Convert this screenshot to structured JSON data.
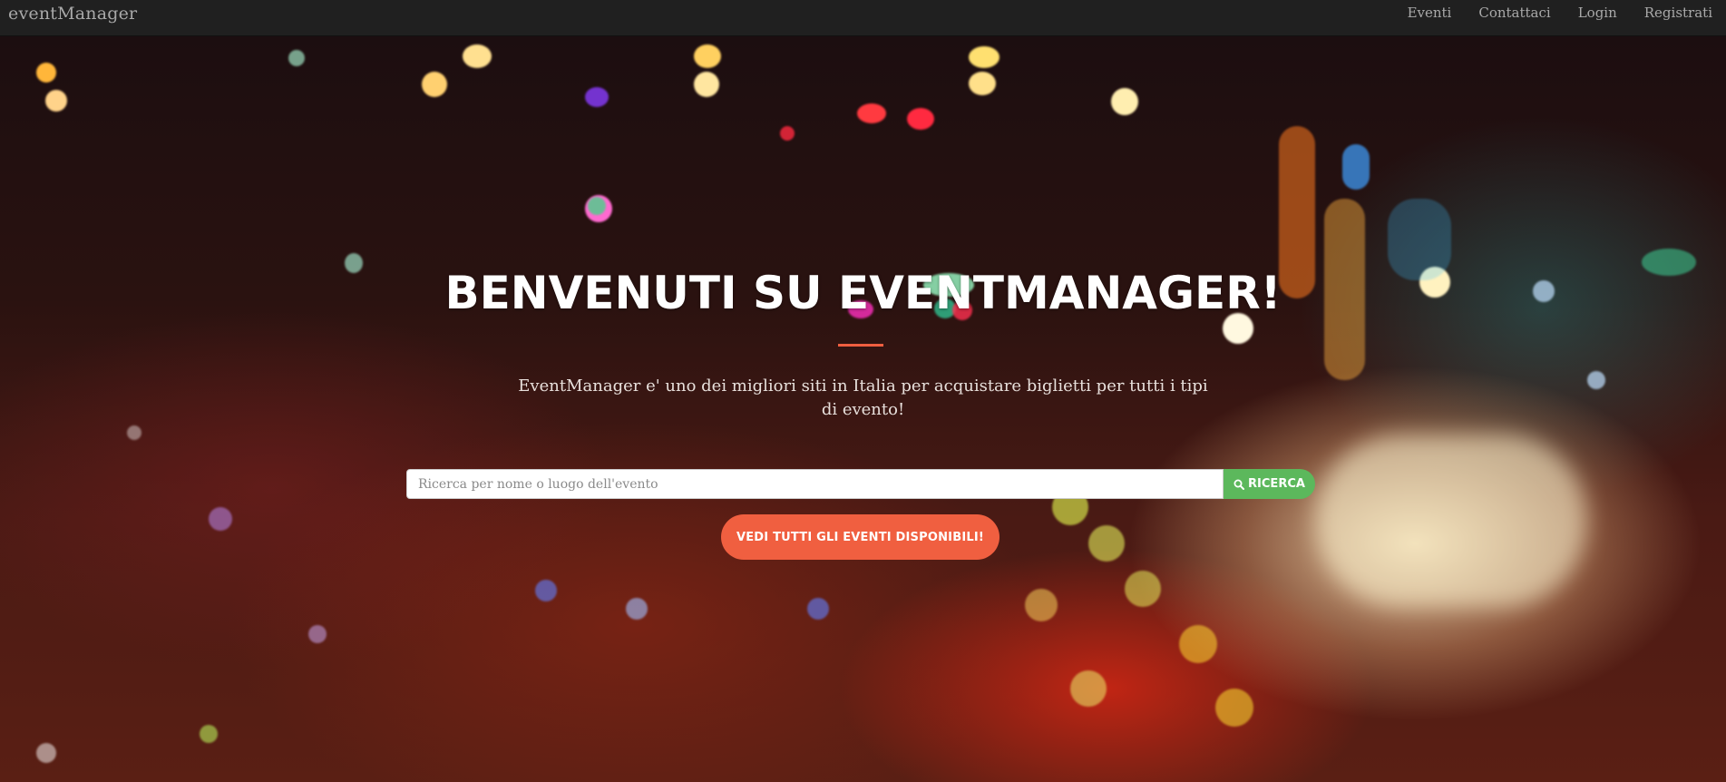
{
  "navbar": {
    "brand": "eventManager",
    "links": [
      "Eventi",
      "Contattaci",
      "Login",
      "Registrati"
    ]
  },
  "hero": {
    "title": "BENVENUTI SU EVENTMANAGER!",
    "subtitle": "EventManager e' uno dei migliori siti in Italia per acquistare biglietti per tutti i tipi di evento!",
    "search": {
      "placeholder": "Ricerca per nome o luogo dell'evento",
      "value": "",
      "button_label": "RICERCA"
    },
    "cta_label": "VEDI TUTTI GLI EVENTI DISPONIBILI!"
  },
  "colors": {
    "accent": "#f05f40",
    "search_button": "#5cb85c",
    "navbar_bg": "#202020"
  },
  "icons": {
    "search_button_icon": "search-icon"
  }
}
